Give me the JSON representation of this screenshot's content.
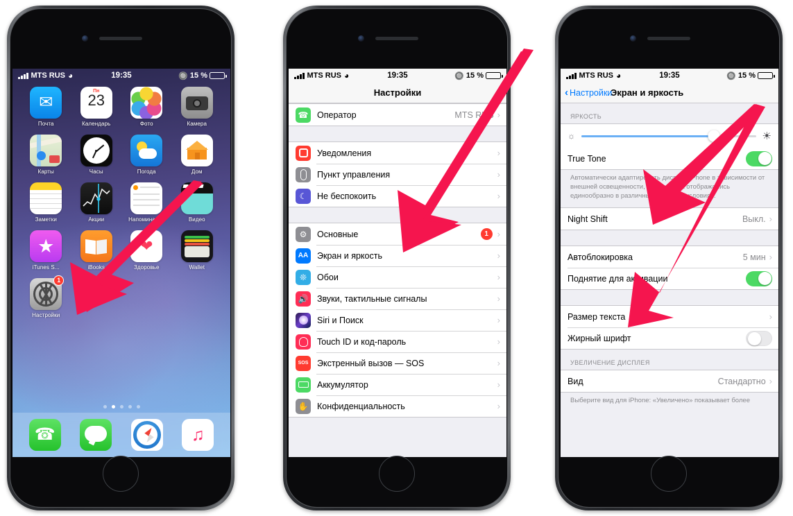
{
  "statusbar": {
    "carrier": "MTS RUS",
    "time": "19:35",
    "battery_percent": "15 %",
    "bluetooth_icon": "bluetooth-icon",
    "wifi_icon": "wifi-icon",
    "signal_icon": "signal-bars-icon"
  },
  "phone1": {
    "name": "iphone-home-screen",
    "apps_row1": [
      {
        "label": "Почта",
        "icon": "mail-icon"
      },
      {
        "label": "Календарь",
        "icon": "calendar-icon",
        "day_short": "Пн",
        "day_number": "23"
      },
      {
        "label": "Фото",
        "icon": "photos-icon"
      },
      {
        "label": "Камера",
        "icon": "camera-icon"
      }
    ],
    "apps_row2": [
      {
        "label": "Карты",
        "icon": "maps-icon"
      },
      {
        "label": "Часы",
        "icon": "clock-icon"
      },
      {
        "label": "Погода",
        "icon": "weather-icon"
      },
      {
        "label": "Дом",
        "icon": "home-app-icon"
      }
    ],
    "apps_row3": [
      {
        "label": "Заметки",
        "icon": "notes-icon"
      },
      {
        "label": "Акции",
        "icon": "stocks-icon"
      },
      {
        "label": "Напоминания",
        "icon": "reminders-icon"
      },
      {
        "label": "Видео",
        "icon": "videos-icon"
      }
    ],
    "apps_row4": [
      {
        "label": "iTunes S...",
        "icon": "itunes-store-icon"
      },
      {
        "label": "iBooks",
        "icon": "ibooks-icon"
      },
      {
        "label": "Здоровье",
        "icon": "health-icon"
      },
      {
        "label": "Wallet",
        "icon": "wallet-icon"
      }
    ],
    "apps_row5": [
      {
        "label": "Настройки",
        "icon": "settings-icon",
        "badge": "1"
      }
    ],
    "page_dots": {
      "total": 5,
      "active_index": 1
    },
    "dock": [
      {
        "label": "Телефон",
        "icon": "phone-icon"
      },
      {
        "label": "Сообщения",
        "icon": "messages-icon"
      },
      {
        "label": "Safari",
        "icon": "safari-icon"
      },
      {
        "label": "Музыка",
        "icon": "music-icon"
      }
    ]
  },
  "phone2": {
    "name": "settings-list-screen",
    "nav_title": "Настройки",
    "sections": [
      {
        "rows": [
          {
            "label": "Оператор",
            "value": "MTS RUS",
            "icon": "phone-green-icon",
            "accessory": "chevron"
          }
        ]
      },
      {
        "rows": [
          {
            "label": "Уведомления",
            "value": "",
            "icon": "notifications-icon",
            "accessory": "chevron"
          },
          {
            "label": "Пункт управления",
            "value": "",
            "icon": "control-center-icon",
            "accessory": "chevron"
          },
          {
            "label": "Не беспокоить",
            "value": "",
            "icon": "do-not-disturb-icon",
            "accessory": "chevron"
          }
        ]
      },
      {
        "rows": [
          {
            "label": "Основные",
            "value": "",
            "icon": "general-gear-icon",
            "accessory": "chevron",
            "badge": "1"
          },
          {
            "label": "Экран и яркость",
            "value": "",
            "icon": "display-brightness-icon",
            "accessory": "chevron"
          },
          {
            "label": "Обои",
            "value": "",
            "icon": "wallpaper-icon",
            "accessory": "chevron"
          },
          {
            "label": "Звуки, тактильные сигналы",
            "value": "",
            "icon": "sounds-haptics-icon",
            "accessory": "chevron"
          },
          {
            "label": "Siri и Поиск",
            "value": "",
            "icon": "siri-search-icon",
            "accessory": "chevron"
          },
          {
            "label": "Touch ID и код-пароль",
            "value": "",
            "icon": "touch-id-icon",
            "accessory": "chevron"
          },
          {
            "label": "Экстренный вызов — SOS",
            "value": "",
            "icon": "sos-icon",
            "accessory": "chevron"
          },
          {
            "label": "Аккумулятор",
            "value": "",
            "icon": "battery-icon",
            "accessory": "chevron"
          },
          {
            "label": "Конфиденциальность",
            "value": "",
            "icon": "privacy-hand-icon",
            "accessory": "chevron"
          }
        ]
      }
    ]
  },
  "phone3": {
    "name": "display-brightness-screen",
    "back_label": "Настройки",
    "nav_title": "Экран и яркость",
    "brightness_header": "ЯРКОСТЬ",
    "brightness_value": 76,
    "true_tone": {
      "label": "True Tone",
      "state": "on"
    },
    "true_tone_footnote": "Автоматически адаптировать дисплей iPhone в зависимости от внешней освещенности, чтобы цвета отображались единообразно в различных световых условиях.",
    "night_shift": {
      "label": "Night Shift",
      "value": "Выкл."
    },
    "autolock": {
      "label": "Автоблокировка",
      "value": "5 мин"
    },
    "raise_to_wake": {
      "label": "Поднятие для активации",
      "state": "on"
    },
    "text_size": {
      "label": "Размер текста"
    },
    "bold_text": {
      "label": "Жирный шрифт",
      "state": "off"
    },
    "zoom_header": "УВЕЛИЧЕНИЕ ДИСПЛЕЯ",
    "view": {
      "label": "Вид",
      "value": "Стандартно"
    },
    "view_footnote": "Выберите вид для iPhone: «Увеличено» показывает более"
  },
  "annotations": {
    "arrow_color": "#f5154e",
    "arrows": [
      {
        "name": "arrow-to-settings-app",
        "target": "Настройки"
      },
      {
        "name": "arrow-to-display-brightness-row",
        "target": "Экран и яркость"
      },
      {
        "name": "arrow-to-true-tone-toggle",
        "target": "True Tone"
      }
    ]
  }
}
